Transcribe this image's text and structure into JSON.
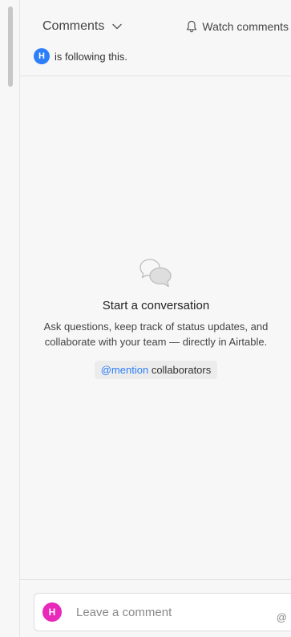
{
  "header": {
    "title": "Comments",
    "watch_label": "Watch comments"
  },
  "following": {
    "avatar_initial": "H",
    "text": "is following this."
  },
  "empty_state": {
    "title": "Start a conversation",
    "desc_line1": "Ask questions, keep track of status updates, and",
    "desc_line2": "collaborate with your team — directly in Airtable.",
    "mention_label": "@mention",
    "mention_suffix": "collaborators"
  },
  "composer": {
    "avatar_initial": "H",
    "placeholder": "Leave a comment",
    "at_symbol": "@"
  },
  "colors": {
    "accent": "#2d7ff9",
    "user_avatar": "#e929ba"
  }
}
